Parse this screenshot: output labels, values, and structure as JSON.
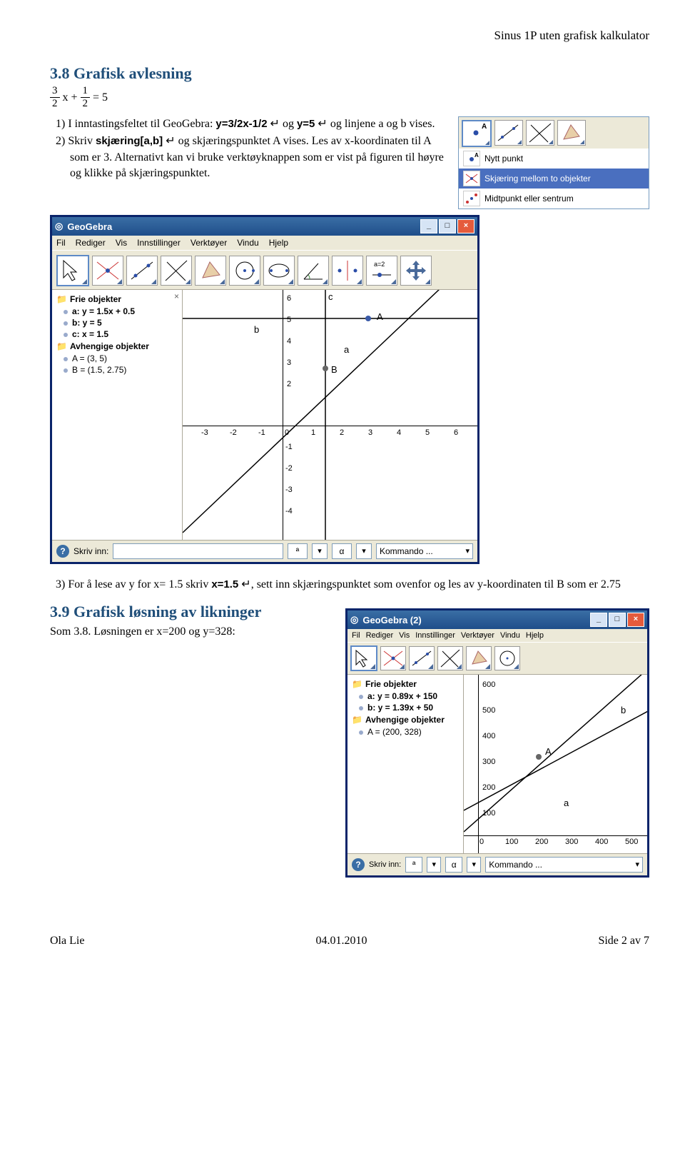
{
  "header_right": "Sinus 1P uten grafisk kalkulator",
  "section38_title": "3.8 Grafisk avlesning",
  "eq": {
    "a_n": "3",
    "a_d": "2",
    "mid": "x +",
    "b_n": "1",
    "b_d": "2",
    "tail": "= 5"
  },
  "item1_pre": "1) I inntastingsfeltet til GeoGebra: ",
  "item1_b1": "y=3/2x-1/2",
  "item1_mid": " ↵ og ",
  "item1_b2": "y=5",
  "item1_post": " ↵ og linjene a og b vises.",
  "item2_pre": "2) Skriv ",
  "item2_b": "skjæring[a,b]",
  "item2_post": " ↵ og skjæringspunktet A vises. Les av x-koordinaten til A som er 3. Alternativt kan vi bruke verktøyknappen som er vist på figuren til høyre og klikke på skjæringspunktet.",
  "popup": {
    "r1": "Nytt punkt",
    "r2": "Skjæring mellom to objekter",
    "r3": "Midtpunkt eller sentrum"
  },
  "ggb1": {
    "title": "GeoGebra",
    "menus": [
      "Fil",
      "Rediger",
      "Vis",
      "Innstillinger",
      "Verktøyer",
      "Vindu",
      "Hjelp"
    ],
    "slider_label": "a = 2",
    "alg_free": "Frie objekter",
    "alg_items_free": [
      "a: y = 1.5x + 0.5",
      "b: y = 5",
      "c: x = 1.5"
    ],
    "alg_dep": "Avhengige objekter",
    "alg_items_dep": [
      "A = (3, 5)",
      "B = (1.5, 2.75)"
    ],
    "xticks": [
      "-3",
      "-2",
      "-1",
      "0",
      "1",
      "2",
      "3",
      "4",
      "5",
      "6"
    ],
    "yticks_pos": [
      "6",
      "5",
      "4",
      "3",
      "2"
    ],
    "yticks_neg": [
      "-1",
      "-2",
      "-3",
      "-4"
    ],
    "labels": {
      "A": "A",
      "B": "B",
      "a": "a",
      "b": "b",
      "c": "c"
    },
    "skriv_inn": "Skriv inn:",
    "kommando": "Kommando ..."
  },
  "item3_pre": "3) For å lese av y for x= 1.5 skriv ",
  "item3_b": "x=1.5",
  "item3_post": " ↵, sett inn skjæringspunktet som ovenfor og les av y-koordinaten til B som er 2.75",
  "section39_title": "3.9 Grafisk løsning av likninger",
  "section39_body": "Som 3.8. Løsningen er x=200 og y=328:",
  "ggb2": {
    "title": "GeoGebra (2)",
    "menus": [
      "Fil",
      "Rediger",
      "Vis",
      "Innstillinger",
      "Verktøyer",
      "Vindu",
      "Hjelp"
    ],
    "alg_free": "Frie objekter",
    "alg_items_free": [
      "a: y = 0.89x + 150",
      "b: y = 1.39x + 50"
    ],
    "alg_dep": "Avhengige objekter",
    "alg_items_dep": [
      "A = (200, 328)"
    ],
    "xticks": [
      "0",
      "100",
      "200",
      "300",
      "400",
      "500"
    ],
    "yticks": [
      "600",
      "500",
      "400",
      "300",
      "200",
      "100",
      "0"
    ],
    "labels": {
      "A": "A",
      "a": "a",
      "b": "b"
    },
    "skriv_inn": "Skriv inn:",
    "kommando": "Kommando ..."
  },
  "footer": {
    "left": "Ola Lie",
    "center": "04.01.2010",
    "right": "Side 2 av 7"
  }
}
